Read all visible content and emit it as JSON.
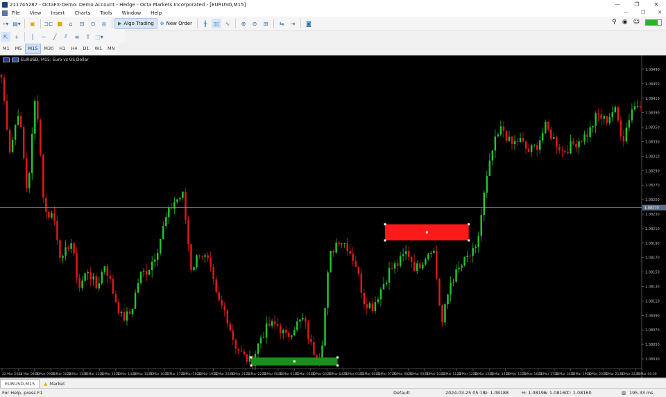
{
  "window": {
    "title": "211745287 - OctaFX-Demo: Demo Account - Hedge - Octa Markets Incorporated - [EURUSD,M15]",
    "controls": [
      "—",
      "❐",
      "✕"
    ]
  },
  "menu": [
    "File",
    "View",
    "Insert",
    "Charts",
    "Tools",
    "Window",
    "Help"
  ],
  "mdi_controls": [
    "—",
    "❐",
    "✕"
  ],
  "toolbar": {
    "algo_label": "Algo Trading",
    "new_order_label": "New Order"
  },
  "timeframes": [
    "M1",
    "M5",
    "M15",
    "M30",
    "H1",
    "H4",
    "D1",
    "W1",
    "MN"
  ],
  "active_timeframe": "M15",
  "connection": {
    "level": 0.75,
    "color": "#28b428"
  },
  "chart_data": {
    "type": "candlestick",
    "title": "EURUSD, M15:  Euro vs US Dollar",
    "price_levels": [
      "1.08490",
      "1.08450",
      "1.08410",
      "1.08390",
      "1.08350",
      "1.08330",
      "1.08310",
      "1.08290",
      "1.08270",
      "1.08250",
      "1.08230",
      "1.08210",
      "1.08190",
      "1.08170",
      "1.08150",
      "1.08130",
      "1.08110",
      "1.08090",
      "1.08070",
      "1.08050",
      "1.08030"
    ],
    "current_price": "1.08270",
    "time_labels": [
      "22 Mar 2024",
      "22 Mar 08:30",
      "22 Mar 09:30",
      "22 Mar 10:30",
      "22 Mar 11:30",
      "22 Mar 12:30",
      "22 Mar 13:30",
      "22 Mar 14:30",
      "22 Mar 15:30",
      "22 Mar 16:30",
      "22 Mar 17:30",
      "22 Mar 18:30",
      "22 Mar 19:30",
      "22 Mar 20:30",
      "22 Mar 21:30",
      "22 Mar 22:30",
      "25 Mar 00:30",
      "25 Mar 01:30",
      "25 Mar 02:30",
      "25 Mar 03:30",
      "25 Mar 04:30",
      "25 Mar 05:30",
      "25 Mar 06:30",
      "25 Mar 07:30",
      "25 Mar 08:30",
      "25 Mar 09:30",
      "25 Mar 10:30",
      "25 Mar 11:30",
      "25 Mar 12:30",
      "25 Mar 13:30",
      "25 Mar 14:30",
      "25 Mar 15:30",
      "25 Mar 16:30",
      "25 Mar 17:30",
      "25 Mar 18:30",
      "25 Mar 19:30",
      "25 Mar 20:30",
      "25 Mar 21:30",
      "25 Mar 22:30",
      "26 Mar 00:30"
    ],
    "up_color": "#22c32e",
    "down_color": "#e01818",
    "y_range": [
      1.0801,
      1.085
    ],
    "zones": [
      {
        "name": "supply-zone",
        "color": "#ff1a1a",
        "price_top": 1.08243,
        "price_bottom": 1.08217,
        "from_candle": 138,
        "to_candle": 168
      },
      {
        "name": "demand-zone",
        "color": "#1a8f1a",
        "price_top": 1.08028,
        "price_bottom": 1.08015,
        "from_candle": 90,
        "to_candle": 121
      }
    ],
    "anchor_path": [
      1.0848,
      1.0836,
      1.0843,
      1.0829,
      1.0846,
      1.0826,
      1.0826,
      1.0818,
      1.0822,
      1.0814,
      1.0817,
      1.0814,
      1.0818,
      1.0813,
      1.0809,
      1.081,
      1.0816,
      1.0817,
      1.082,
      1.0825,
      1.0828,
      1.0829,
      1.0817,
      1.082,
      1.0818,
      1.0812,
      1.081,
      1.0805,
      1.0803,
      1.0802,
      1.0806,
      1.0808,
      1.0808,
      1.0806,
      1.0808,
      1.0809,
      1.0804,
      1.0803,
      1.0819,
      1.0822,
      1.0821,
      1.0818,
      1.0812,
      1.0811,
      1.0814,
      1.0817,
      1.0818,
      1.082,
      1.0817,
      1.0819,
      1.0821,
      1.0808,
      1.0815,
      1.0817,
      1.0819,
      1.082,
      1.083,
      1.0837,
      1.084,
      1.0837,
      1.0838,
      1.0836,
      1.0837,
      1.084,
      1.0838,
      1.0836,
      1.0837,
      1.0838,
      1.0839,
      1.0842,
      1.0841,
      1.0843,
      1.0838,
      1.0843,
      1.0844
    ]
  },
  "bottom_tabs": [
    {
      "label": "EURUSD,M15",
      "active": true
    },
    {
      "label": "Market",
      "active": false
    }
  ],
  "status": {
    "help": "For Help, press F1",
    "profile": "Default",
    "datetime": "2024.03.25 05:15",
    "open": "O: 1.08188",
    "high": "H: 1.08196",
    "low": "L: 1.08160",
    "close": "C: 1.08160",
    "ping": "195.33 ms"
  }
}
